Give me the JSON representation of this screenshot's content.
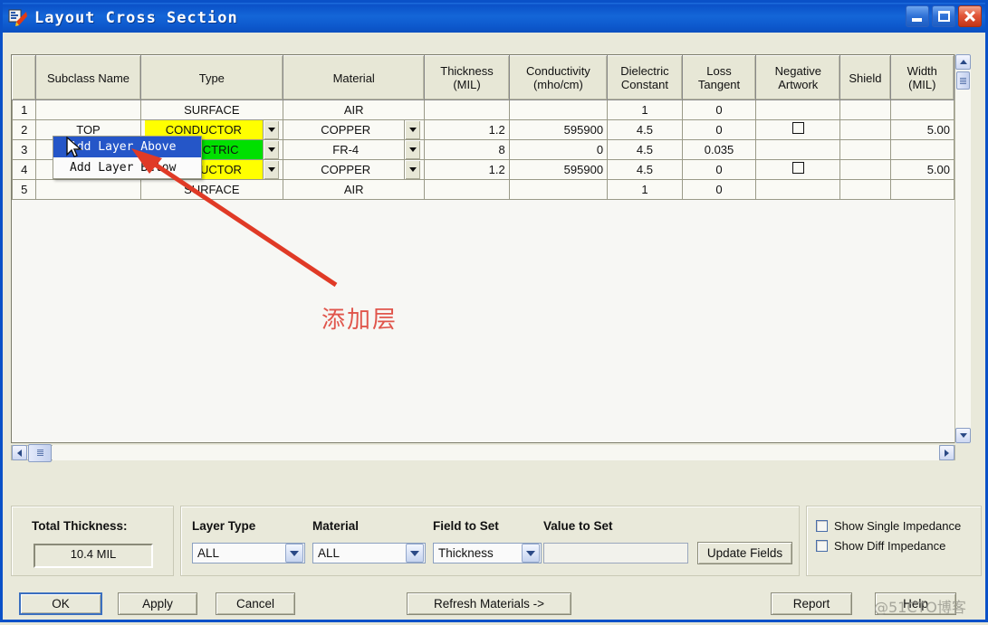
{
  "window": {
    "title": "Layout Cross Section",
    "icon": "app-icon",
    "buttons": {
      "minimize": "minimize-button",
      "maximize": "maximize-button",
      "close": "close-button"
    }
  },
  "grid": {
    "columns": [
      {
        "key": "rownum",
        "label": ""
      },
      {
        "key": "subclass",
        "label": "Subclass Name"
      },
      {
        "key": "type",
        "label": "Type"
      },
      {
        "key": "material",
        "label": "Material"
      },
      {
        "key": "thickness",
        "label": "Thickness\n(MIL)",
        "line1": "Thickness",
        "line2": "(MIL)"
      },
      {
        "key": "conduct",
        "label": "Conductivity\n(mho/cm)",
        "line1": "Conductivity",
        "line2": "(mho/cm)"
      },
      {
        "key": "dielec",
        "label": "Dielectric\nConstant",
        "line1": "Dielectric",
        "line2": "Constant"
      },
      {
        "key": "loss",
        "label": "Loss\nTangent",
        "line1": "Loss",
        "line2": "Tangent"
      },
      {
        "key": "negart",
        "label": "Negative\nArtwork",
        "line1": "Negative",
        "line2": "Artwork"
      },
      {
        "key": "shield",
        "label": "Shield"
      },
      {
        "key": "width",
        "label": "Width\n(MIL)",
        "line1": "Width",
        "line2": "(MIL)"
      }
    ],
    "rows": [
      {
        "num": "1",
        "subclass": "",
        "type": "SURFACE",
        "type_color": "none",
        "type_dropdown": false,
        "material": "AIR",
        "material_dropdown": false,
        "thickness": "",
        "conduct": "",
        "dielec": "1",
        "loss": "0",
        "negart": "",
        "shield": "",
        "width": ""
      },
      {
        "num": "2",
        "subclass": "TOP",
        "type": "CONDUCTOR",
        "type_color": "yellow",
        "type_dropdown": true,
        "material": "COPPER",
        "material_dropdown": true,
        "thickness": "1.2",
        "conduct": "595900",
        "dielec": "4.5",
        "loss": "0",
        "negart": "checkbox",
        "shield": "",
        "width": "5.00"
      },
      {
        "num": "3",
        "subclass": "",
        "type": "DIELECTRIC",
        "type_color": "green",
        "type_dropdown": true,
        "material": "FR-4",
        "material_dropdown": true,
        "thickness": "8",
        "conduct": "0",
        "dielec": "4.5",
        "loss": "0.035",
        "negart": "",
        "shield": "",
        "width": ""
      },
      {
        "num": "4",
        "subclass": "",
        "type": "CONDUCTOR",
        "type_color": "yellow",
        "type_dropdown": true,
        "material": "COPPER",
        "material_dropdown": true,
        "thickness": "1.2",
        "conduct": "595900",
        "dielec": "4.5",
        "loss": "0",
        "negart": "checkbox",
        "shield": "",
        "width": "5.00"
      },
      {
        "num": "5",
        "subclass": "",
        "type": "SURFACE",
        "type_color": "none",
        "type_dropdown": false,
        "material": "AIR",
        "material_dropdown": false,
        "thickness": "",
        "conduct": "",
        "dielec": "1",
        "loss": "0",
        "negart": "",
        "shield": "",
        "width": ""
      }
    ]
  },
  "context_menu": {
    "items": [
      {
        "label": "Add Layer Above",
        "selected": true
      },
      {
        "label": "Add Layer Below",
        "selected": false
      }
    ]
  },
  "annotation": {
    "text": "添加层",
    "color": "#e0554b"
  },
  "watermark": {
    "text": "@51CTO博客"
  },
  "bottom": {
    "total_thickness": {
      "label": "Total Thickness:",
      "value": "10.4 MIL"
    },
    "layer_type": {
      "label": "Layer Type",
      "value": "ALL"
    },
    "material": {
      "label": "Material",
      "value": "ALL"
    },
    "field_to_set": {
      "label": "Field to Set",
      "value": "Thickness"
    },
    "value_to_set": {
      "label": "Value to Set",
      "value": "",
      "placeholder": ""
    },
    "update_fields": "Update Fields",
    "checkboxes": [
      {
        "label": "Show Single Impedance",
        "checked": false
      },
      {
        "label": "Show Diff Impedance",
        "checked": false
      }
    ]
  },
  "actions": {
    "ok": "OK",
    "apply": "Apply",
    "cancel": "Cancel",
    "refresh_materials": "Refresh Materials ->",
    "report": "Report",
    "help": "Help"
  }
}
